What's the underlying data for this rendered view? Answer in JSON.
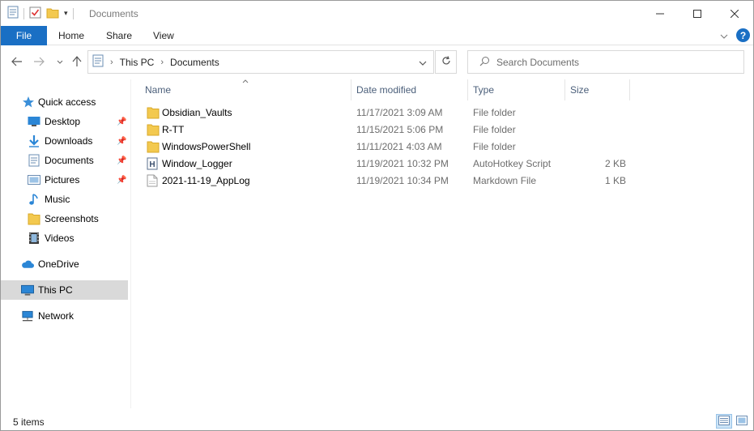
{
  "window": {
    "title": "Documents",
    "controls": {
      "minimize": "—",
      "maximize": "☐",
      "close": "✕"
    }
  },
  "ribbon": {
    "tabs": [
      {
        "label": "File",
        "active": true
      },
      {
        "label": "Home"
      },
      {
        "label": "Share"
      },
      {
        "label": "View"
      }
    ],
    "expand_icon": "chevron-down-icon",
    "help_label": "?"
  },
  "navigation": {
    "breadcrumb": [
      "This PC",
      "Documents"
    ],
    "search_placeholder": "Search Documents"
  },
  "sidebar": {
    "items": [
      {
        "label": "Quick access",
        "icon": "star-icon",
        "level": 0
      },
      {
        "label": "Desktop",
        "icon": "desktop-icon",
        "level": 1,
        "pinned": true
      },
      {
        "label": "Downloads",
        "icon": "download-icon",
        "level": 1,
        "pinned": true
      },
      {
        "label": "Documents",
        "icon": "documents-icon",
        "level": 1,
        "pinned": true
      },
      {
        "label": "Pictures",
        "icon": "pictures-icon",
        "level": 1,
        "pinned": true
      },
      {
        "label": "Music",
        "icon": "music-icon",
        "level": 1
      },
      {
        "label": "Screenshots",
        "icon": "folder-icon",
        "level": 1
      },
      {
        "label": "Videos",
        "icon": "videos-icon",
        "level": 1
      },
      {
        "label": "OneDrive",
        "icon": "cloud-icon",
        "level": 0
      },
      {
        "label": "This PC",
        "icon": "computer-icon",
        "level": 0,
        "selected": true
      },
      {
        "label": "Network",
        "icon": "network-icon",
        "level": 0
      }
    ]
  },
  "columns": [
    "Name",
    "Date modified",
    "Type",
    "Size"
  ],
  "files": [
    {
      "name": "Obsidian_Vaults",
      "date": "11/17/2021 3:09 AM",
      "type": "File folder",
      "size": "",
      "icon": "folder-icon"
    },
    {
      "name": "R-TT",
      "date": "11/15/2021 5:06 PM",
      "type": "File folder",
      "size": "",
      "icon": "folder-icon"
    },
    {
      "name": "WindowsPowerShell",
      "date": "11/11/2021 4:03 AM",
      "type": "File folder",
      "size": "",
      "icon": "folder-icon"
    },
    {
      "name": "Window_Logger",
      "date": "11/19/2021 10:32 PM",
      "type": "AutoHotkey Script",
      "size": "2 KB",
      "icon": "ahk-script-icon"
    },
    {
      "name": "2021-11-19_AppLog",
      "date": "11/19/2021 10:34 PM",
      "type": "Markdown File",
      "size": "1 KB",
      "icon": "markdown-file-icon"
    }
  ],
  "status": {
    "item_count": "5 items"
  },
  "colors": {
    "accent": "#1a6fc4",
    "folder": "#f3c94f",
    "selected": "#d9d9d9"
  }
}
